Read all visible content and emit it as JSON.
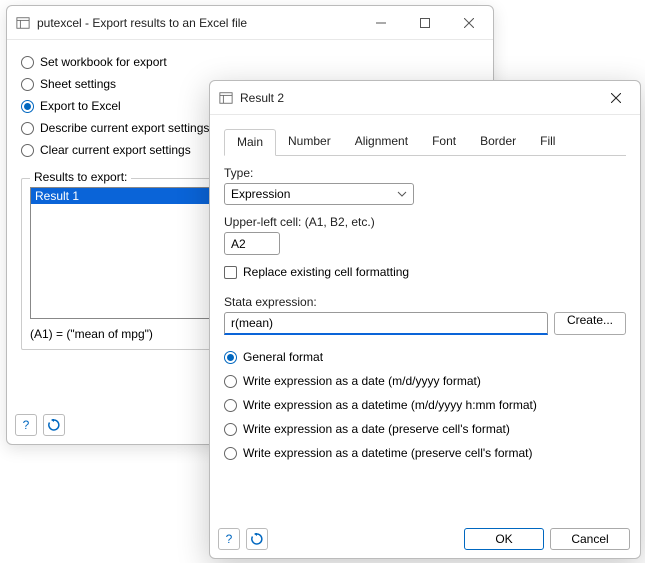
{
  "back": {
    "title": "putexcel - Export results to an Excel file",
    "radios": {
      "set_workbook": "Set workbook for export",
      "sheet_settings": "Sheet settings",
      "export_excel": "Export to Excel",
      "describe": "Describe current export settings",
      "clear": "Clear current export settings"
    },
    "results_label": "Results to export:",
    "result_item": "Result 1",
    "expr_preview": "(A1) = (\"mean of mpg\")"
  },
  "front": {
    "title": "Result 2",
    "tabs": {
      "main": "Main",
      "number": "Number",
      "alignment": "Alignment",
      "font": "Font",
      "border": "Border",
      "fill": "Fill"
    },
    "type_label": "Type:",
    "type_value": "Expression",
    "cell_label": "Upper-left cell: (A1, B2, etc.)",
    "cell_value": "A2",
    "replace_fmt": "Replace existing cell formatting",
    "stata_expr_label": "Stata expression:",
    "stata_expr_value": "r(mean)",
    "create_btn": "Create...",
    "fmt": {
      "general": "General format",
      "date": "Write expression as a date (m/d/yyyy format)",
      "datetime": "Write expression as a datetime (m/d/yyyy h:mm format)",
      "date_preserve": "Write expression as a date (preserve cell's format)",
      "datetime_preserve": "Write expression as a datetime (preserve cell's format)"
    },
    "ok": "OK",
    "cancel": "Cancel"
  }
}
